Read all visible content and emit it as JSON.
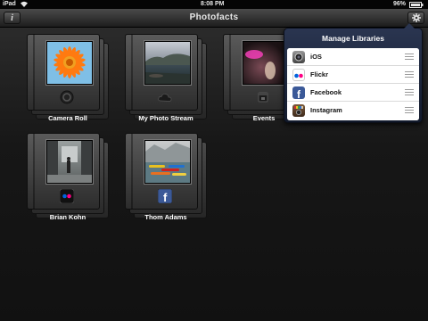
{
  "status_bar": {
    "device": "iPad",
    "time": "8:08 PM",
    "battery": "96%"
  },
  "nav": {
    "info_icon_glyph": "i",
    "title": "Photofacts",
    "settings_icon": "gear-icon"
  },
  "albums": [
    {
      "label": "Camera Roll",
      "badge": "camera-icon"
    },
    {
      "label": "My Photo Stream",
      "badge": "cloud-icon"
    },
    {
      "label": "Events",
      "badge": "calendar-icon"
    },
    {
      "label": "Brian Kohn",
      "badge": "flickr-icon"
    },
    {
      "label": "Thom Adams",
      "badge": "facebook-icon"
    }
  ],
  "popover": {
    "title": "Manage Libraries",
    "items": [
      {
        "label": "iOS",
        "icon": "camera-icon"
      },
      {
        "label": "Flickr",
        "icon": "flickr-icon"
      },
      {
        "label": "Facebook",
        "icon": "facebook-icon"
      },
      {
        "label": "Instagram",
        "icon": "instagram-icon"
      }
    ]
  },
  "colors": {
    "flickr_blue": "#0063dc",
    "flickr_pink": "#ff0084",
    "facebook_blue": "#3b5998"
  }
}
